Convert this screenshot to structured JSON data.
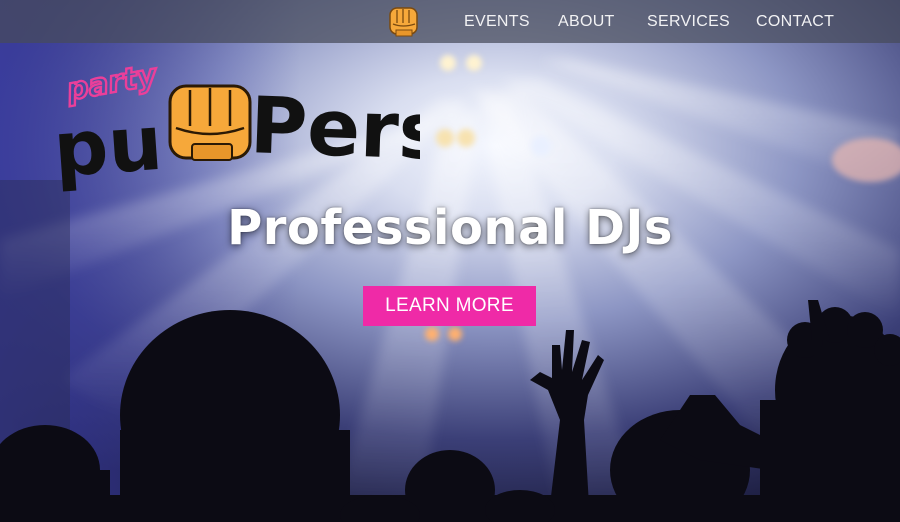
{
  "nav": {
    "links": [
      "EVENTS",
      "ABOUT",
      "SERVICES",
      "CONTACT"
    ]
  },
  "logo": {
    "word_top": "party",
    "word_bottom": "pumpers",
    "colors": {
      "top": "#ea3f9a",
      "bottom": "#111111",
      "fist": "#f6a83a"
    }
  },
  "hero": {
    "headline": "Professional DJs",
    "cta_label": "LEARN MORE"
  },
  "colors": {
    "cta": "#ef2aa7",
    "nav_bg": "#464b5a"
  },
  "icons": {
    "nav_logo": "fist-icon"
  }
}
